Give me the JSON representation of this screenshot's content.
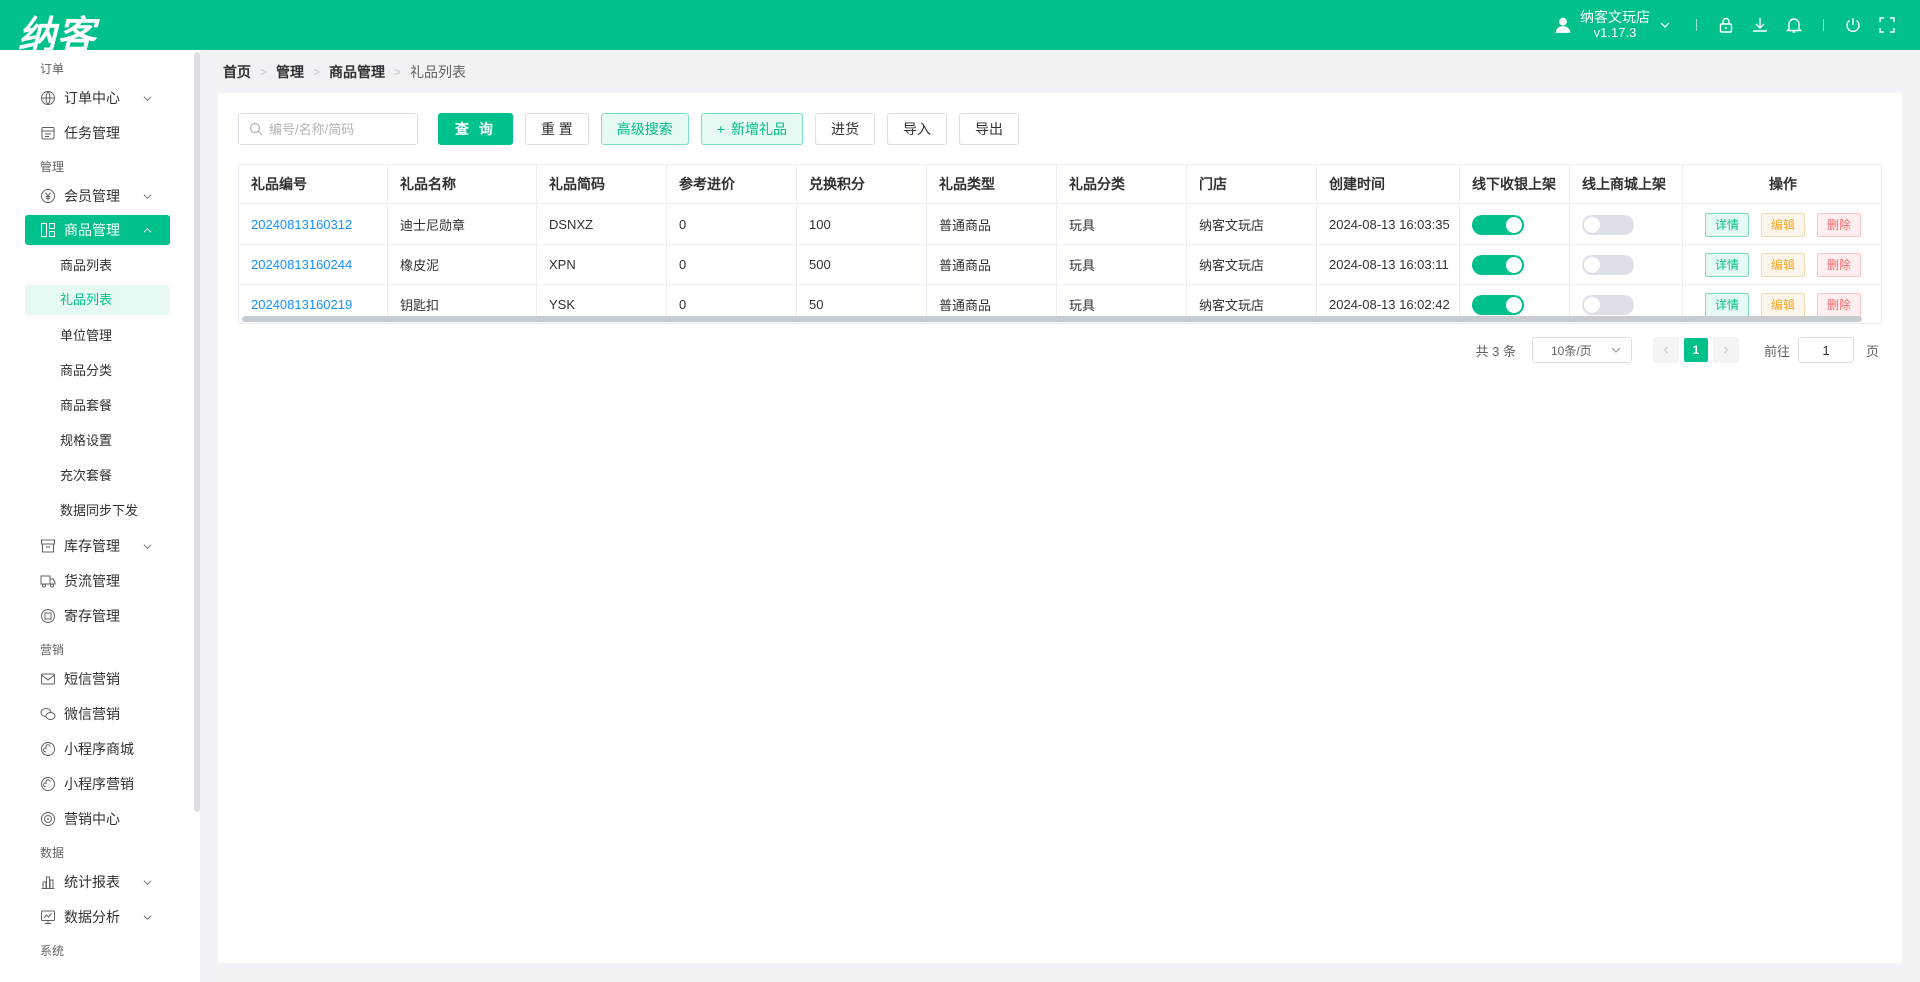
{
  "header": {
    "logo": "纳客",
    "store_name": "纳客文玩店",
    "version": "v1.17.3"
  },
  "sidebar": {
    "sections": [
      {
        "label": "订单"
      },
      {
        "label": "管理"
      },
      {
        "label": "营销"
      },
      {
        "label": "数据"
      },
      {
        "label": "系统"
      }
    ],
    "items": {
      "order_center": "订单中心",
      "task_mgmt": "任务管理",
      "member_mgmt": "会员管理",
      "goods_mgmt": "商品管理",
      "stock_mgmt": "库存管理",
      "logistics_mgmt": "货流管理",
      "deposit_mgmt": "寄存管理",
      "sms_marketing": "短信营销",
      "wechat_marketing": "微信营销",
      "mini_mall": "小程序商城",
      "mini_marketing": "小程序营销",
      "marketing_center": "营销中心",
      "stat_report": "统计报表",
      "data_analysis": "数据分析"
    },
    "goods_sub": [
      "商品列表",
      "礼品列表",
      "单位管理",
      "商品分类",
      "商品套餐",
      "规格设置",
      "充次套餐",
      "数据同步下发"
    ]
  },
  "breadcrumb": [
    "首页",
    "管理",
    "商品管理",
    "礼品列表"
  ],
  "toolbar": {
    "search_placeholder": "编号/名称/简码",
    "query": "查 询",
    "reset": "重 置",
    "advanced": "高级搜索",
    "add_gift": "新增礼品",
    "purchase": "进货",
    "import": "导入",
    "export": "导出"
  },
  "table": {
    "headers": [
      "礼品编号",
      "礼品名称",
      "礼品简码",
      "参考进价",
      "兑换积分",
      "礼品类型",
      "礼品分类",
      "门店",
      "创建时间",
      "线下收银上架",
      "线上商城上架",
      "操作"
    ],
    "rows": [
      {
        "code": "20240813160312",
        "name": "迪士尼勋章",
        "short": "DSNXZ",
        "price": "0",
        "points": "100",
        "type": "普通商品",
        "category": "玩具",
        "store": "纳客文玩店",
        "time": "2024-08-13 16:03:35",
        "offline": true,
        "online": false
      },
      {
        "code": "20240813160244",
        "name": "橡皮泥",
        "short": "XPN",
        "price": "0",
        "points": "500",
        "type": "普通商品",
        "category": "玩具",
        "store": "纳客文玩店",
        "time": "2024-08-13 16:03:11",
        "offline": true,
        "online": false
      },
      {
        "code": "20240813160219",
        "name": "钥匙扣",
        "short": "YSK",
        "price": "0",
        "points": "50",
        "type": "普通商品",
        "category": "玩具",
        "store": "纳客文玩店",
        "time": "2024-08-13 16:02:42",
        "offline": true,
        "online": false
      }
    ],
    "op_labels": {
      "detail": "详情",
      "edit": "编辑",
      "delete": "删除"
    }
  },
  "pagination": {
    "total": "共 3 条",
    "page_size": "10条/页",
    "current_page": "1",
    "goto_label": "前往",
    "goto_value": "1",
    "page_suffix": "页"
  },
  "colors": {
    "primary": "#00c08b",
    "link": "#1890ff",
    "warning": "#f5a623",
    "danger": "#f56c6c"
  }
}
